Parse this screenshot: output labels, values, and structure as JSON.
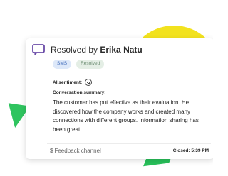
{
  "card": {
    "title_prefix": "Resolved by ",
    "agent_name": "Erika Natu",
    "tags": [
      "SMS",
      "Resolved"
    ],
    "sentiment_label": "AI sentiment:",
    "sentiment_icon": "neutral-face-icon",
    "summary_label": "Conversation summary:",
    "summary_text": "The customer has put effective as their evaluation. He discovered how the company works and created many connections with different groups. Information sharing has been great",
    "channel_icon": "$",
    "channel_label": "Feedback channel",
    "closed_label": "Closed: 5:39 PM"
  },
  "colors": {
    "chat_icon": "#6b4ca8",
    "yellow_deco": "#f2e21e",
    "green_deco": "#2fc45f",
    "sms_tag_bg": "#dde8f9",
    "sms_tag_text": "#3b67b8",
    "resolved_tag_bg": "#e4eee5",
    "resolved_tag_text": "#6d8d73"
  },
  "icons": {
    "header": "chat-bubble-icon",
    "sentiment": "neutral-face-icon",
    "channel": "dollar-icon"
  }
}
